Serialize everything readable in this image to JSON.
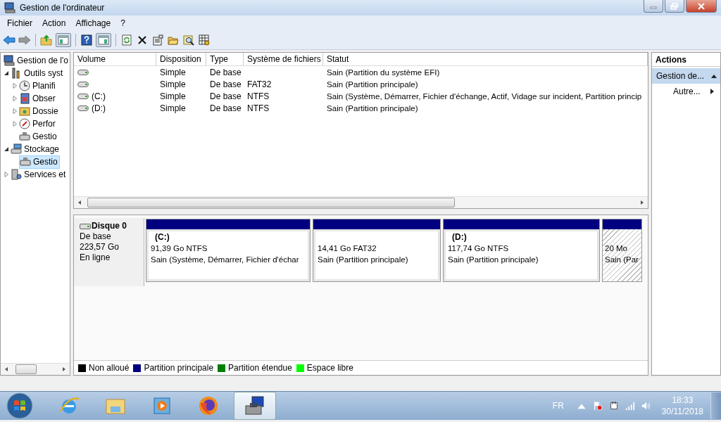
{
  "window": {
    "title": "Gestion de l'ordinateur"
  },
  "menu": [
    "Fichier",
    "Action",
    "Affichage",
    "?"
  ],
  "toolbar": {
    "toggles": [
      {
        "pressed": true
      },
      {
        "pressed": true
      }
    ]
  },
  "tree": [
    {
      "label": "Gestion de l'o",
      "selected": false,
      "children": [
        {
          "label": "Outils syst",
          "expanded": true,
          "selected": false,
          "children": [
            {
              "label": "Planifi",
              "expanded": false,
              "selected": false
            },
            {
              "label": "Obser",
              "expanded": false,
              "selected": false
            },
            {
              "label": "Dossie",
              "expanded": false,
              "selected": false
            },
            {
              "label": "Perfor",
              "expanded": false,
              "selected": false
            },
            {
              "label": "Gestio",
              "selected": false
            }
          ]
        },
        {
          "label": "Stockage",
          "expanded": true,
          "selected": false,
          "children": [
            {
              "label": "Gestio",
              "selected": true
            }
          ]
        },
        {
          "label": "Services et",
          "expanded": false,
          "selected": false
        }
      ]
    }
  ],
  "volumes": {
    "columns": [
      "Volume",
      "Disposition",
      "Type",
      "Système de fichiers",
      "Statut"
    ],
    "rows": [
      {
        "disposition": "Simple",
        "type": "De base",
        "status": "Sain (Partition du système EFI)"
      },
      {
        "disposition": "Simple",
        "type": "De base",
        "filesystem": "FAT32",
        "status": "Sain (Partition principale)"
      },
      {
        "volume": "(C:)",
        "disposition": "Simple",
        "type": "De base",
        "filesystem": "NTFS",
        "status": "Sain (Système, Démarrer, Fichier d'échange, Actif, Vidage sur incident, Partition princip"
      },
      {
        "volume": "(D:)",
        "disposition": "Simple",
        "type": "De base",
        "filesystem": "NTFS",
        "status": "Sain (Partition principale)"
      }
    ]
  },
  "disk": {
    "name": "Disque 0",
    "type": "De base",
    "size": "223,57 Go",
    "state": "En ligne",
    "partitions": [
      {
        "name": "(C:)",
        "size": "91,39 Go NTFS",
        "status": "Sain (Système, Démarrer, Fichier d'échar",
        "kind": "primary",
        "selected": false
      },
      {
        "size": "14,41 Go FAT32",
        "status": "Sain (Partition principale)",
        "kind": "primary",
        "selected": false
      },
      {
        "name": "(D:)",
        "size": "117,74 Go NTFS",
        "status": "Sain (Partition principale)",
        "kind": "primary",
        "selected": false
      },
      {
        "size": "20 Mo",
        "status": "Sain (Par",
        "kind": "primary",
        "selected": true
      }
    ]
  },
  "legend": [
    {
      "label": "Non alloué",
      "color": "#000000"
    },
    {
      "label": "Partition principale",
      "color": "#000080"
    },
    {
      "label": "Partition étendue",
      "color": "#008000"
    },
    {
      "label": "Espace libre",
      "color": "#00ff00"
    }
  ],
  "actions": {
    "title": "Actions",
    "items": [
      {
        "label": "Gestion de...",
        "kind": "section",
        "expanded": true
      },
      {
        "label": "Autre...",
        "kind": "submenu"
      }
    ]
  },
  "taskbar_apps": [
    {
      "active": false
    },
    {
      "active": false
    },
    {
      "active": false
    },
    {
      "active": false
    },
    {
      "active": true
    }
  ],
  "tray": {
    "language": "FR",
    "time": "18:33",
    "date": "30/11/2018"
  }
}
